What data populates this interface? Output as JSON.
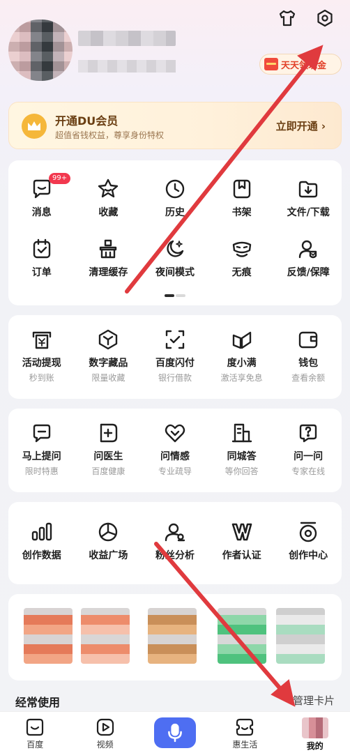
{
  "header": {
    "shirt_icon": "shirt-icon",
    "settings_icon": "gear-icon",
    "cash_pill_label": "天天领现金"
  },
  "vip": {
    "title": "开通DU会员",
    "subtitle": "超值省钱权益，尊享身份特权",
    "action": "立即开通 ›"
  },
  "quick_grid": {
    "badge": "99+",
    "row1": [
      {
        "label": "消息",
        "icon": "message-icon"
      },
      {
        "label": "收藏",
        "icon": "star-icon"
      },
      {
        "label": "历史",
        "icon": "clock-icon"
      },
      {
        "label": "书架",
        "icon": "bookmark-icon"
      },
      {
        "label": "文件/下载",
        "icon": "download-icon"
      }
    ],
    "row2": [
      {
        "label": "订单",
        "icon": "order-icon"
      },
      {
        "label": "清理缓存",
        "icon": "clean-icon"
      },
      {
        "label": "夜间模式",
        "icon": "moon-icon"
      },
      {
        "label": "无痕",
        "icon": "mask-icon"
      },
      {
        "label": "反馈/保障",
        "icon": "feedback-icon"
      }
    ]
  },
  "finance": [
    {
      "label": "活动提现",
      "sub": "秒到账",
      "icon": "withdraw-icon"
    },
    {
      "label": "数字藏品",
      "sub": "限量收藏",
      "icon": "cube-icon"
    },
    {
      "label": "百度闪付",
      "sub": "银行借款",
      "icon": "scan-pay-icon"
    },
    {
      "label": "度小满",
      "sub": "激活享免息",
      "icon": "duxiaoman-icon"
    },
    {
      "label": "钱包",
      "sub": "查看余额",
      "icon": "wallet-icon"
    }
  ],
  "consult": [
    {
      "label": "马上提问",
      "sub": "限时特惠",
      "icon": "ask-icon"
    },
    {
      "label": "问医生",
      "sub": "百度健康",
      "icon": "doctor-icon"
    },
    {
      "label": "问情感",
      "sub": "专业疏导",
      "icon": "heart-icon"
    },
    {
      "label": "同城答",
      "sub": "等你回答",
      "icon": "city-icon"
    },
    {
      "label": "问一问",
      "sub": "专家在线",
      "icon": "question-icon"
    }
  ],
  "creator": [
    {
      "label": "创作数据",
      "icon": "bar-chart-icon"
    },
    {
      "label": "收益广场",
      "icon": "pie-icon"
    },
    {
      "label": "粉丝分析",
      "icon": "fans-icon"
    },
    {
      "label": "作者认证",
      "icon": "verify-icon"
    },
    {
      "label": "创作中心",
      "icon": "creator-center-icon"
    }
  ],
  "section": {
    "title": "经常使用",
    "manage": "管理卡片"
  },
  "nav": [
    {
      "label": "百度",
      "icon": "baidu-icon"
    },
    {
      "label": "视频",
      "icon": "video-icon"
    },
    {
      "label": "",
      "icon": "mic-icon"
    },
    {
      "label": "惠生活",
      "icon": "life-icon"
    },
    {
      "label": "我的",
      "icon": "profile-icon"
    }
  ],
  "colors": {
    "accent": "#4e6ef2",
    "badge": "#f2384e",
    "vip_text": "#6a3e12",
    "annotation_arrow": "#e03a3e"
  }
}
